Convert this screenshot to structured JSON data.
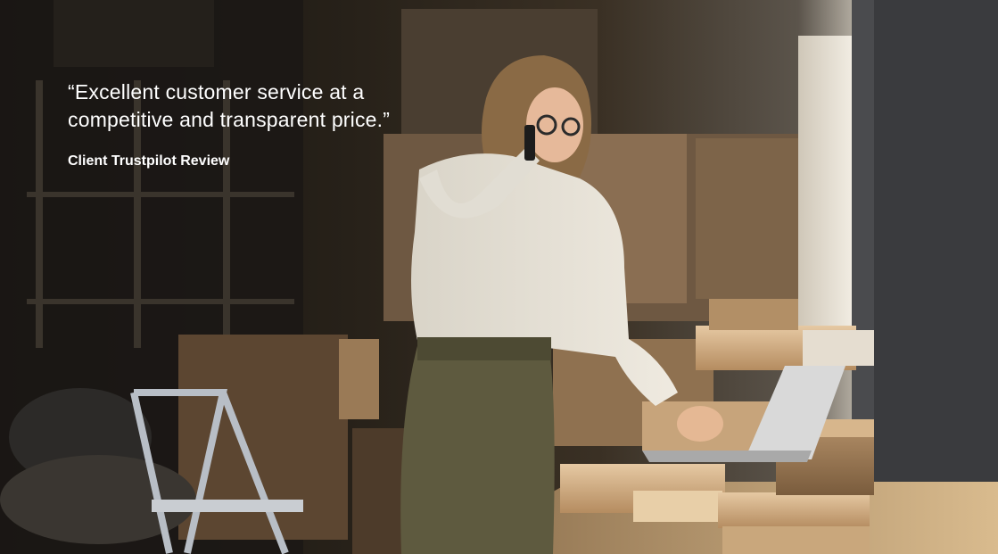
{
  "hero": {
    "quote": "“Excellent customer service at a competitive and transparent price.”",
    "source": "Client Trustpilot Review"
  }
}
